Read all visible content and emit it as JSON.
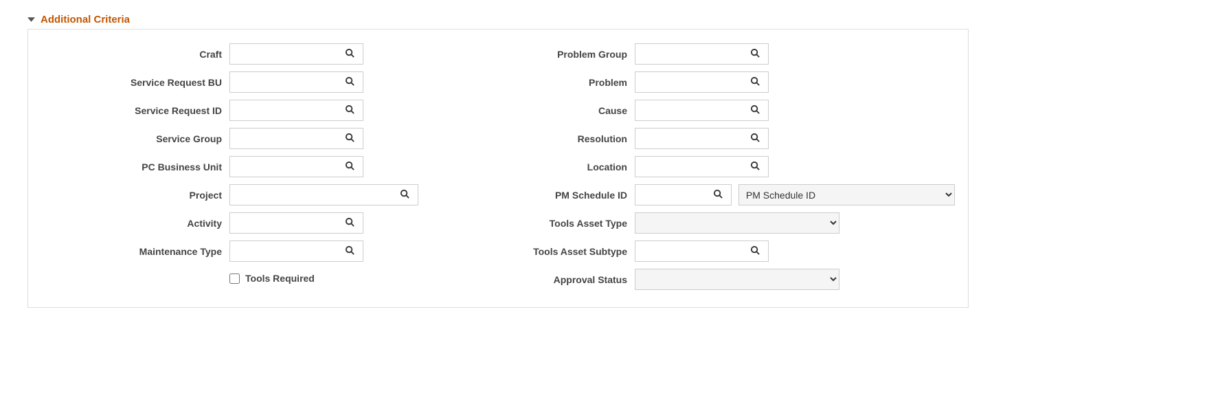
{
  "section": {
    "title": "Additional Criteria"
  },
  "left": {
    "craft": {
      "label": "Craft",
      "value": ""
    },
    "service_request_bu": {
      "label": "Service Request BU",
      "value": ""
    },
    "service_request_id": {
      "label": "Service Request ID",
      "value": ""
    },
    "service_group": {
      "label": "Service Group",
      "value": ""
    },
    "pc_business_unit": {
      "label": "PC Business Unit",
      "value": ""
    },
    "project": {
      "label": "Project",
      "value": ""
    },
    "activity": {
      "label": "Activity",
      "value": ""
    },
    "maintenance_type": {
      "label": "Maintenance Type",
      "value": ""
    },
    "tools_required": {
      "label": "Tools Required",
      "checked": false
    }
  },
  "right": {
    "problem_group": {
      "label": "Problem Group",
      "value": ""
    },
    "problem": {
      "label": "Problem",
      "value": ""
    },
    "cause": {
      "label": "Cause",
      "value": ""
    },
    "resolution": {
      "label": "Resolution",
      "value": ""
    },
    "location": {
      "label": "Location",
      "value": ""
    },
    "pm_schedule_id": {
      "label": "PM Schedule ID",
      "value": "",
      "select_value": "PM Schedule ID",
      "options": [
        "PM Schedule ID"
      ]
    },
    "tools_asset_type": {
      "label": "Tools Asset Type",
      "value": "",
      "options": [
        ""
      ]
    },
    "tools_asset_subtype": {
      "label": "Tools Asset Subtype",
      "value": ""
    },
    "approval_status": {
      "label": "Approval Status",
      "value": "",
      "options": [
        ""
      ]
    }
  }
}
